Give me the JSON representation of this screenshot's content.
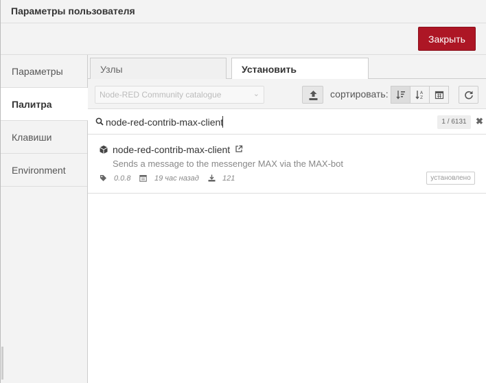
{
  "dialog": {
    "title": "Параметры пользователя",
    "close_label": "Закрыть",
    "accent_color": "#ad1625"
  },
  "sidebar": {
    "items": [
      {
        "label": "Параметры",
        "active": false
      },
      {
        "label": "Палитра",
        "active": true
      },
      {
        "label": "Клавиши",
        "active": false
      },
      {
        "label": "Environment",
        "active": false
      }
    ]
  },
  "tabs": [
    {
      "label": "Узлы",
      "active": false
    },
    {
      "label": "Установить",
      "active": true
    }
  ],
  "filters": {
    "catalog": "Node-RED Community catalogue",
    "sort_label": "сортировать:",
    "sort_options": [
      "relevance-sort-icon",
      "alpha-sort-icon",
      "date-sort-icon"
    ],
    "selected_sort": 0
  },
  "search": {
    "value": "node-red-contrib-max-client",
    "count": "1 / 6131"
  },
  "results": [
    {
      "name": "node-red-contrib-max-client",
      "description": "Sends a message to the messenger MAX via the MAX-bot",
      "version": "0.0.8",
      "updated": "19 час назад",
      "downloads": "121",
      "status": "установлено"
    }
  ]
}
